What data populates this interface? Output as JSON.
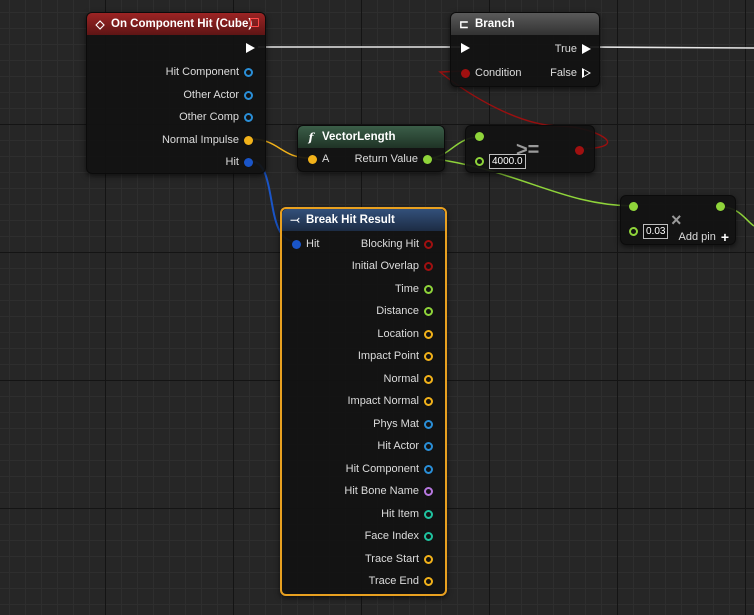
{
  "colors": {
    "exec": "#ffffff",
    "object": "#2a8fd8",
    "vector": "#f2b21a",
    "float": "#8fd43a",
    "bool": "#a01010",
    "name": "#b778e0",
    "int": "#1fc3a0",
    "struct": "#1a55c8",
    "selection": "#e8a020"
  },
  "event_node": {
    "title": "On Component Hit (Cube)",
    "icon": "event-diamond-icon",
    "pins": [
      "Hit Component",
      "Other Actor",
      "Other Comp",
      "Normal Impulse",
      "Hit"
    ]
  },
  "branch_node": {
    "title": "Branch",
    "icon": "branch-icon",
    "condition": "Condition",
    "true_label": "True",
    "false_label": "False"
  },
  "vectorlength_node": {
    "title": "VectorLength",
    "icon": "function-icon",
    "input": "A",
    "output": "Return Value"
  },
  "compare_node": {
    "symbol": ">=",
    "value": "4000.0"
  },
  "multiply_node": {
    "symbol": "×",
    "value": "0.03",
    "add_pin": "Add pin",
    "add_icon": "+"
  },
  "break_node": {
    "title": "Break Hit Result",
    "icon": "break-struct-icon",
    "input": "Hit",
    "pins": [
      "Blocking Hit",
      "Initial Overlap",
      "Time",
      "Distance",
      "Location",
      "Impact Point",
      "Normal",
      "Impact Normal",
      "Phys Mat",
      "Hit Actor",
      "Hit Component",
      "Hit Bone Name",
      "Hit Item",
      "Face Index",
      "Trace Start",
      "Trace End"
    ]
  }
}
